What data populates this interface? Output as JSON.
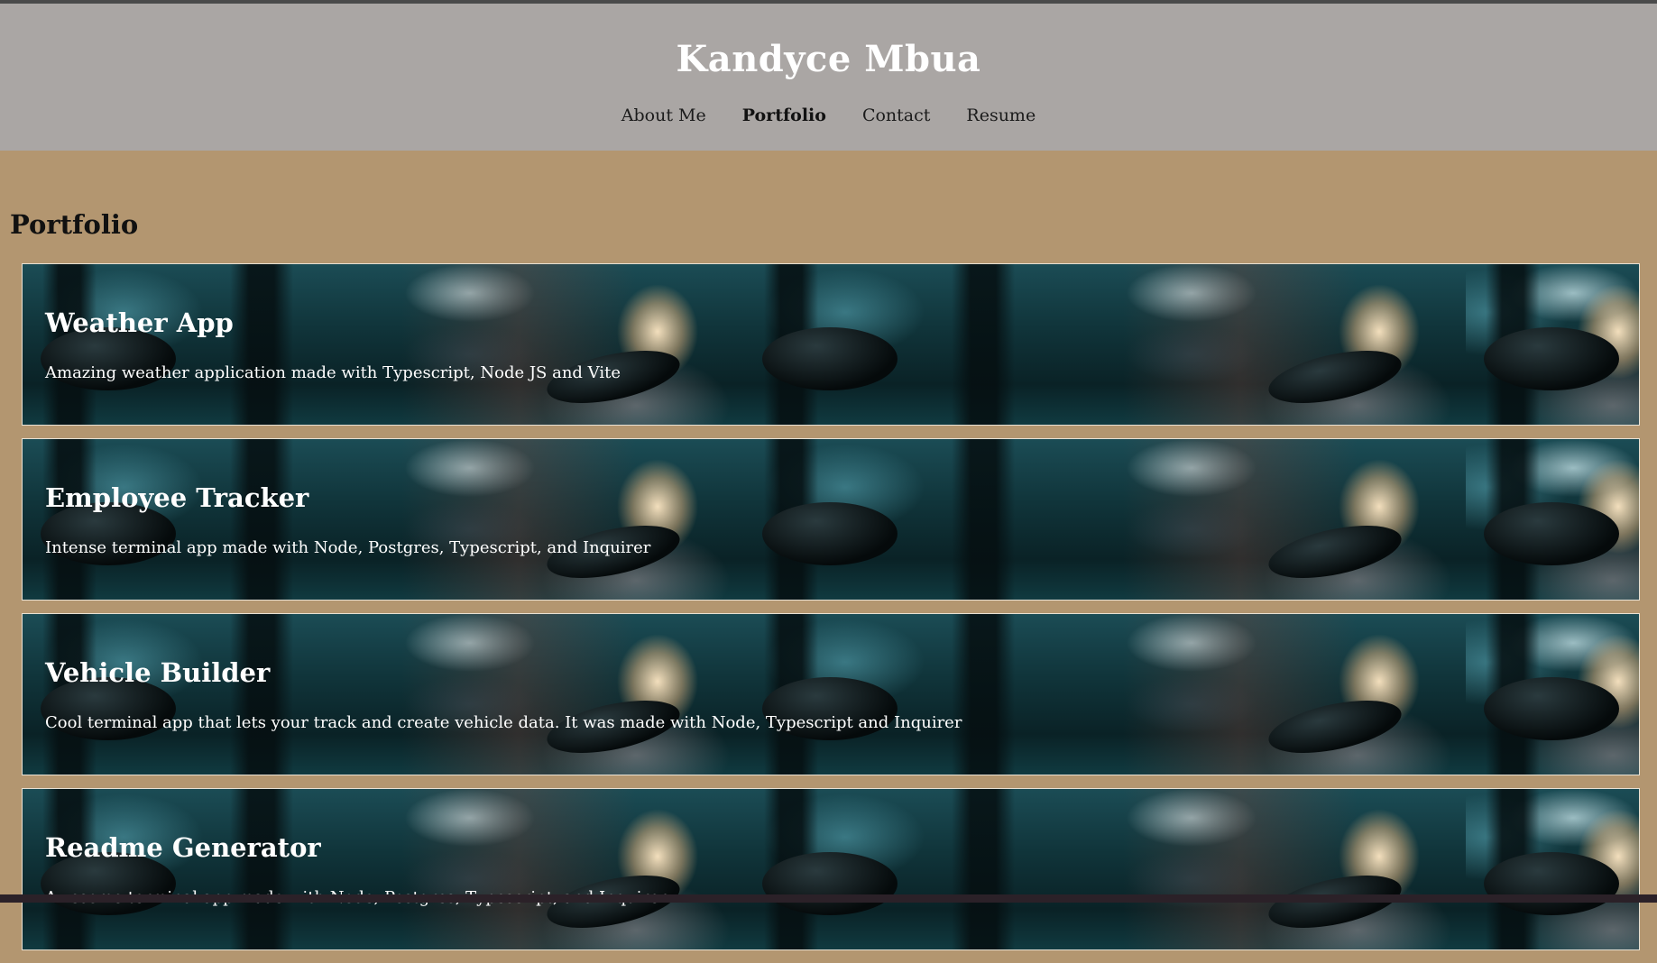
{
  "header": {
    "site_title": "Kandyce Mbua",
    "nav": [
      {
        "label": "About Me",
        "active": false
      },
      {
        "label": "Portfolio",
        "active": true
      },
      {
        "label": "Contact",
        "active": false
      },
      {
        "label": "Resume",
        "active": false
      }
    ]
  },
  "main": {
    "heading": "Portfolio",
    "projects": [
      {
        "title": "Weather App",
        "description": "Amazing weather application made with Typescript, Node JS and Vite"
      },
      {
        "title": "Employee Tracker",
        "description": "Intense terminal app made with Node, Postgres, Typescript, and Inquirer"
      },
      {
        "title": "Vehicle Builder",
        "description": "Cool terminal app that lets your track and create vehicle data. It was made with Node, Typescript and Inquirer"
      },
      {
        "title": "Readme Generator",
        "description": "Awesome terminal app made with Node, Postgres, Typescript, and Inquirer"
      }
    ]
  },
  "colors": {
    "page_background": "#b39670",
    "header_background": "#aaa6a4",
    "title_text": "#ffffff"
  }
}
